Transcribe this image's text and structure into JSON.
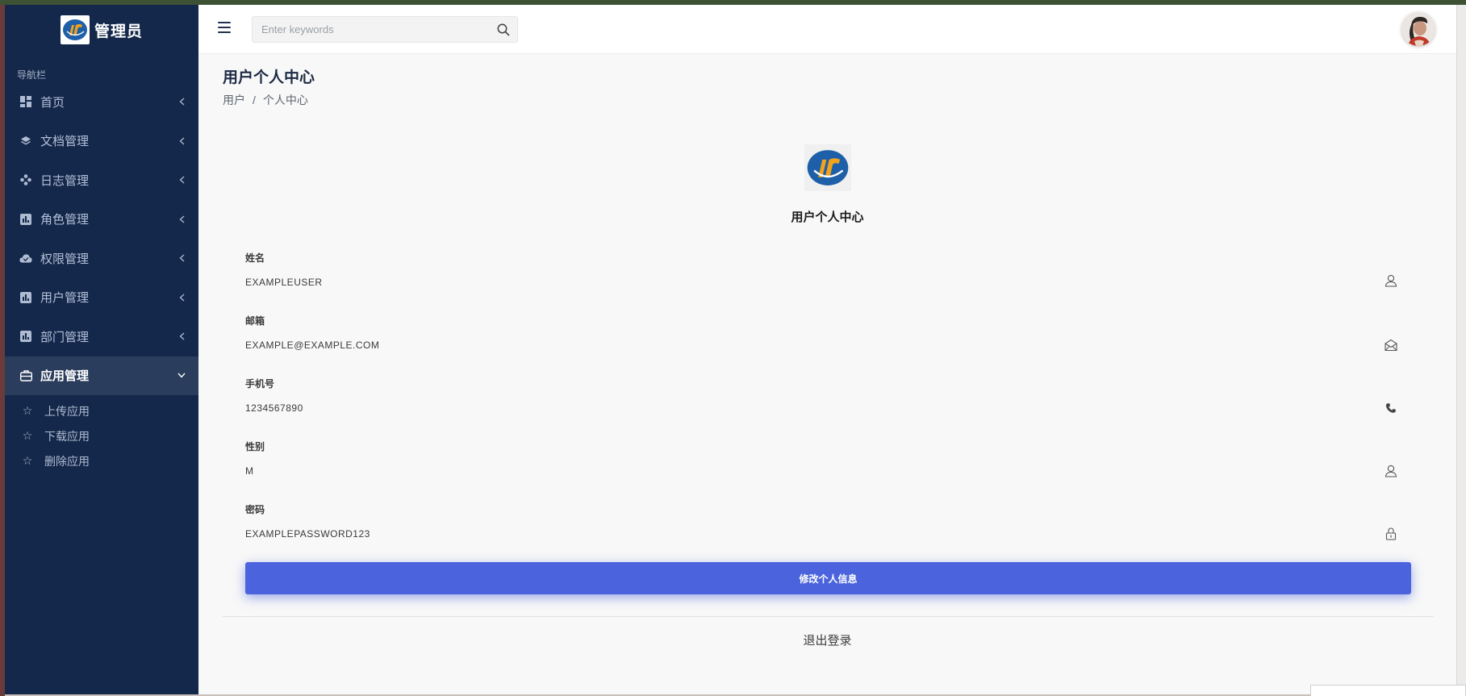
{
  "brand": {
    "title": "管理员"
  },
  "sidebar": {
    "caption": "导航栏",
    "items": [
      {
        "label": "首页",
        "icon": "dashboard-icon"
      },
      {
        "label": "文档管理",
        "icon": "layers-icon"
      },
      {
        "label": "日志管理",
        "icon": "gamepad-icon"
      },
      {
        "label": "角色管理",
        "icon": "bar-chart-icon"
      },
      {
        "label": "权限管理",
        "icon": "cloud-icon"
      },
      {
        "label": "用户管理",
        "icon": "bar-chart-icon"
      },
      {
        "label": "部门管理",
        "icon": "bar-chart-icon"
      },
      {
        "label": "应用管理",
        "icon": "briefcase-icon",
        "expanded": true
      }
    ],
    "sub_items": [
      {
        "label": "上传应用",
        "icon": "star-icon"
      },
      {
        "label": "下载应用",
        "icon": "star-icon"
      },
      {
        "label": "删除应用",
        "icon": "star-icon"
      }
    ]
  },
  "header": {
    "search_placeholder": "Enter keywords"
  },
  "page": {
    "title": "用户个人中心",
    "breadcrumb": [
      "用户",
      "个人中心"
    ],
    "profile_heading": "用户个人中心",
    "fields": [
      {
        "label": "姓名",
        "value": "EXAMPLEUSER",
        "icon": "user-icon"
      },
      {
        "label": "邮箱",
        "value": "EXAMPLE@EXAMPLE.COM",
        "icon": "mail-open-icon"
      },
      {
        "label": "手机号",
        "value": "1234567890",
        "icon": "phone-icon"
      },
      {
        "label": "性别",
        "value": "M",
        "icon": "user-icon"
      },
      {
        "label": "密码",
        "value": "EXAMPLEPASSWORD123",
        "icon": "lock-icon"
      }
    ],
    "submit_label": "修改个人信息",
    "logout_label": "退出登录"
  },
  "colors": {
    "sidebar_bg": "#14284b",
    "sidebar_active": "#2b3d5c",
    "primary": "#4b64dd",
    "content_bg": "#f8f8f8"
  }
}
